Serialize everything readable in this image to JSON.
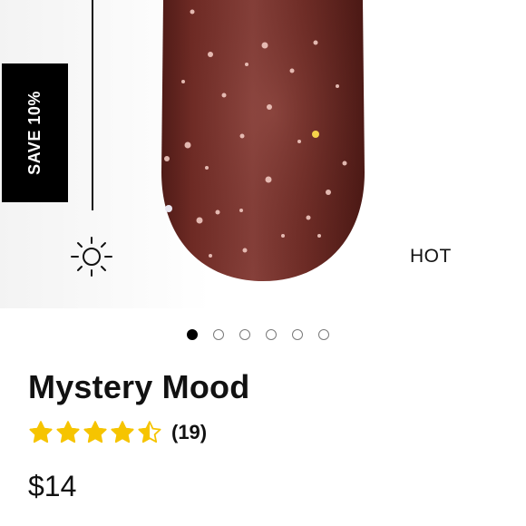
{
  "product": {
    "badge": "SAVE 10%",
    "temperature_label": "HOT",
    "title": "Mystery Mood",
    "rating_value": 4.5,
    "review_count": "(19)",
    "price": "$14"
  },
  "carousel": {
    "total_slides": 6,
    "active_index": 0
  },
  "colors": {
    "star": "#f6c400",
    "badge_bg": "#000000",
    "nail_base": "#6b2a25"
  },
  "icons": {
    "temperature": "sun-icon",
    "rating": "star-icon"
  }
}
